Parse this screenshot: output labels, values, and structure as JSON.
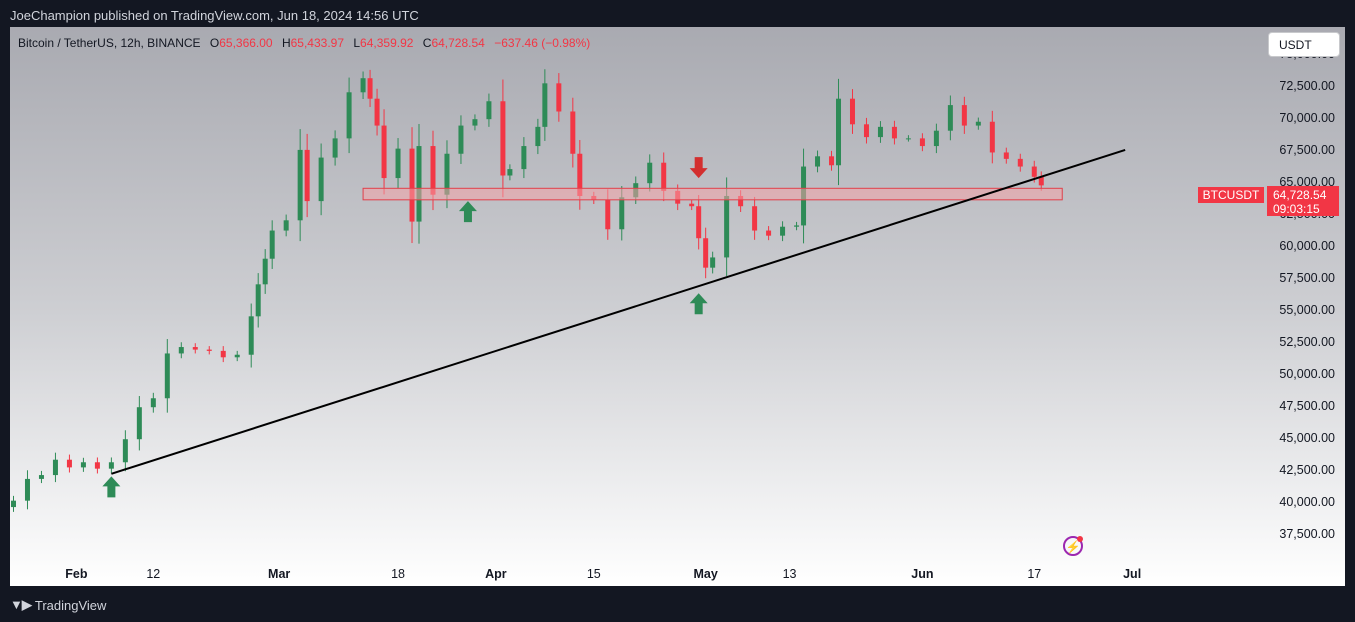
{
  "header": {
    "publish_line": "JoeChampion published on TradingView.com, Jun 18, 2024 14:56 UTC"
  },
  "legend": {
    "symbol": "Bitcoin / TetherUS, 12h, BINANCE",
    "open_label": "O",
    "open": "65,366.00",
    "high_label": "H",
    "high": "65,433.97",
    "low_label": "L",
    "low": "64,359.92",
    "close_label": "C",
    "close": "64,728.54",
    "change": "−637.46 (−0.98%)"
  },
  "currency_button": "USDT",
  "price_tag": {
    "symbol": "BTCUSDT",
    "price": "64,728.54",
    "countdown": "09:03:15"
  },
  "footer": {
    "brand": "TradingView"
  },
  "colors": {
    "up": "#2e8b57",
    "down": "#f23645",
    "zone_fill": "#f4a3a8",
    "zone_border": "#e0404a",
    "trendline": "#000000"
  },
  "chart_data": {
    "type": "candlestick",
    "y_tick_labels": [
      "75,000.00",
      "72,500.00",
      "70,000.00",
      "67,500.00",
      "65,000.00",
      "62,500.00",
      "60,000.00",
      "57,500.00",
      "55,000.00",
      "52,500.00",
      "50,000.00",
      "47,500.00",
      "45,000.00",
      "42,500.00",
      "40,000.00",
      "37,500.00"
    ],
    "y_ticks": [
      75000,
      72500,
      70000,
      67500,
      65000,
      62500,
      60000,
      57500,
      55000,
      52500,
      50000,
      47500,
      45000,
      42500,
      40000,
      37500
    ],
    "ylim": [
      35700,
      77100
    ],
    "x_ticks": [
      {
        "label": "Feb",
        "date": "2024-02-01",
        "bold": true
      },
      {
        "label": "12",
        "date": "2024-02-12",
        "bold": false
      },
      {
        "label": "Mar",
        "date": "2024-03-01",
        "bold": true
      },
      {
        "label": "18",
        "date": "2024-03-18",
        "bold": false
      },
      {
        "label": "Apr",
        "date": "2024-04-01",
        "bold": true
      },
      {
        "label": "15",
        "date": "2024-04-15",
        "bold": false
      },
      {
        "label": "May",
        "date": "2024-05-01",
        "bold": true
      },
      {
        "label": "13",
        "date": "2024-05-13",
        "bold": false
      },
      {
        "label": "Jun",
        "date": "2024-06-01",
        "bold": true
      },
      {
        "label": "17",
        "date": "2024-06-17",
        "bold": false
      },
      {
        "label": "Jul",
        "date": "2024-07-01",
        "bold": true
      }
    ],
    "xlim": [
      "2024-01-22T12:00",
      "2024-07-19T00:00"
    ],
    "candle_interval": "12h",
    "candles": [
      {
        "t": "2024-01-23",
        "close": 40100
      },
      {
        "t": "2024-01-25",
        "close": 41800
      },
      {
        "t": "2024-01-27",
        "close": 42100
      },
      {
        "t": "2024-01-29",
        "close": 43300
      },
      {
        "t": "2024-01-31",
        "close": 42700
      },
      {
        "t": "2024-02-02",
        "close": 43100
      },
      {
        "t": "2024-02-04",
        "close": 42600
      },
      {
        "t": "2024-02-06",
        "close": 43100
      },
      {
        "t": "2024-02-08",
        "close": 44900
      },
      {
        "t": "2024-02-10",
        "close": 47400
      },
      {
        "t": "2024-02-12",
        "close": 48100
      },
      {
        "t": "2024-02-14",
        "close": 51600
      },
      {
        "t": "2024-02-16",
        "close": 52100
      },
      {
        "t": "2024-02-18",
        "close": 51900
      },
      {
        "t": "2024-02-20",
        "close": 51800
      },
      {
        "t": "2024-02-22",
        "close": 51300
      },
      {
        "t": "2024-02-24",
        "close": 51500
      },
      {
        "t": "2024-02-26",
        "close": 54500
      },
      {
        "t": "2024-02-27",
        "close": 57000
      },
      {
        "t": "2024-02-28",
        "close": 59000
      },
      {
        "t": "2024-02-29",
        "close": 61200
      },
      {
        "t": "2024-03-02",
        "close": 62000
      },
      {
        "t": "2024-03-04",
        "close": 67500
      },
      {
        "t": "2024-03-05",
        "close": 63500
      },
      {
        "t": "2024-03-07",
        "close": 66900
      },
      {
        "t": "2024-03-09",
        "close": 68400
      },
      {
        "t": "2024-03-11",
        "close": 72000
      },
      {
        "t": "2024-03-13",
        "close": 73100
      },
      {
        "t": "2024-03-14",
        "close": 71500
      },
      {
        "t": "2024-03-15",
        "close": 69400
      },
      {
        "t": "2024-03-16",
        "close": 65300
      },
      {
        "t": "2024-03-18",
        "close": 67600
      },
      {
        "t": "2024-03-20",
        "close": 61900
      },
      {
        "t": "2024-03-21",
        "close": 67800
      },
      {
        "t": "2024-03-23",
        "close": 64000
      },
      {
        "t": "2024-03-25",
        "close": 67200
      },
      {
        "t": "2024-03-27",
        "close": 69400
      },
      {
        "t": "2024-03-29",
        "close": 69900
      },
      {
        "t": "2024-03-31",
        "close": 71300
      },
      {
        "t": "2024-04-02",
        "close": 65500
      },
      {
        "t": "2024-04-03",
        "close": 66000
      },
      {
        "t": "2024-04-05",
        "close": 67800
      },
      {
        "t": "2024-04-07",
        "close": 69300
      },
      {
        "t": "2024-04-08",
        "close": 72700
      },
      {
        "t": "2024-04-10",
        "close": 70500
      },
      {
        "t": "2024-04-12",
        "close": 67200
      },
      {
        "t": "2024-04-13",
        "close": 63900
      },
      {
        "t": "2024-04-15",
        "close": 63600
      },
      {
        "t": "2024-04-17",
        "close": 61300
      },
      {
        "t": "2024-04-19",
        "close": 63800
      },
      {
        "t": "2024-04-21",
        "close": 64900
      },
      {
        "t": "2024-04-23",
        "close": 66500
      },
      {
        "t": "2024-04-25",
        "close": 64300
      },
      {
        "t": "2024-04-27",
        "close": 63300
      },
      {
        "t": "2024-04-29",
        "close": 63100
      },
      {
        "t": "2024-04-30",
        "close": 60600
      },
      {
        "t": "2024-05-01",
        "close": 58300
      },
      {
        "t": "2024-05-02",
        "close": 59100
      },
      {
        "t": "2024-05-04",
        "close": 63900
      },
      {
        "t": "2024-05-06",
        "close": 63100
      },
      {
        "t": "2024-05-08",
        "close": 61200
      },
      {
        "t": "2024-05-10",
        "close": 60800
      },
      {
        "t": "2024-05-12",
        "close": 61500
      },
      {
        "t": "2024-05-14",
        "close": 61600
      },
      {
        "t": "2024-05-15",
        "close": 66200
      },
      {
        "t": "2024-05-17",
        "close": 67000
      },
      {
        "t": "2024-05-19",
        "close": 66300
      },
      {
        "t": "2024-05-20",
        "close": 71500
      },
      {
        "t": "2024-05-22",
        "close": 69500
      },
      {
        "t": "2024-05-24",
        "close": 68500
      },
      {
        "t": "2024-05-26",
        "close": 69300
      },
      {
        "t": "2024-05-28",
        "close": 68400
      },
      {
        "t": "2024-05-30",
        "close": 68400
      },
      {
        "t": "2024-06-01",
        "close": 67800
      },
      {
        "t": "2024-06-03",
        "close": 69000
      },
      {
        "t": "2024-06-05",
        "close": 71000
      },
      {
        "t": "2024-06-07",
        "close": 69400
      },
      {
        "t": "2024-06-09",
        "close": 69700
      },
      {
        "t": "2024-06-11",
        "close": 67300
      },
      {
        "t": "2024-06-13",
        "close": 66800
      },
      {
        "t": "2024-06-15",
        "close": 66200
      },
      {
        "t": "2024-06-17",
        "close": 65400
      },
      {
        "t": "2024-06-18",
        "close": 64728.54
      }
    ],
    "annotations": {
      "resistance_zone": {
        "from": "2024-03-13",
        "to": "2024-06-21",
        "low": 63600,
        "high": 64500
      },
      "trendline": {
        "from": {
          "t": "2024-02-06",
          "price": 42200
        },
        "to": {
          "t": "2024-06-30",
          "price": 67500
        }
      },
      "arrows": [
        {
          "t": "2024-02-06",
          "price": 42000,
          "direction": "up",
          "color": "#2e8b57"
        },
        {
          "t": "2024-03-28",
          "price": 63500,
          "direction": "up",
          "color": "#2e8b57"
        },
        {
          "t": "2024-04-30",
          "price": 56300,
          "direction": "up",
          "color": "#2e8b57"
        },
        {
          "t": "2024-04-30",
          "price": 65300,
          "direction": "down",
          "color": "#d32f2f"
        }
      ]
    }
  }
}
